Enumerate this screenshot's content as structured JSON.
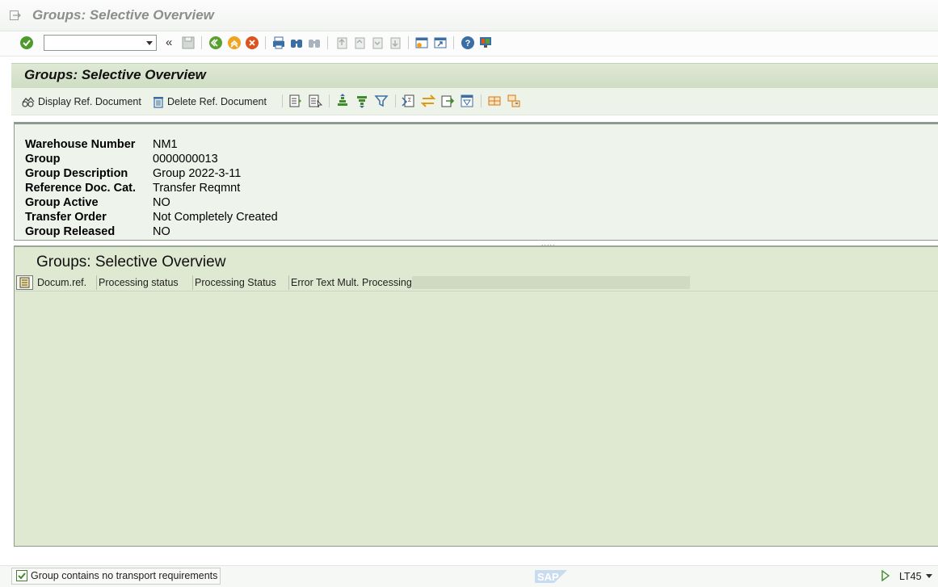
{
  "window": {
    "title": "Groups: Selective Overview"
  },
  "page": {
    "title": "Groups: Selective Overview"
  },
  "app_toolbar": {
    "display_ref_doc": "Display Ref. Document",
    "delete_ref_doc": "Delete Ref. Document"
  },
  "header_fields": [
    {
      "label": "Warehouse Number",
      "value": "NM1"
    },
    {
      "label": "Group",
      "value": "0000000013"
    },
    {
      "label": "Group Description",
      "value": "Group 2022-3-11"
    },
    {
      "label": "Reference Doc. Cat.",
      "value": "Transfer Reqmnt"
    },
    {
      "label": "Group Active",
      "value": "NO"
    },
    {
      "label": "Transfer Order",
      "value": "Not Completely Created"
    },
    {
      "label": "Group Released",
      "value": "NO"
    }
  ],
  "splitter": ".....",
  "grid": {
    "title": "Groups: Selective Overview",
    "columns": [
      "Docum.ref.",
      "Processing status",
      "Processing Status",
      "Error Text Mult. Processing"
    ]
  },
  "status_bar": {
    "message": "Group contains no transport requirements",
    "tcode": "LT45",
    "logo": "SAP"
  },
  "colors": {
    "header_green": "#cfddc3",
    "grid_green": "#dfe8d1",
    "panel_green": "#eef4eb"
  }
}
